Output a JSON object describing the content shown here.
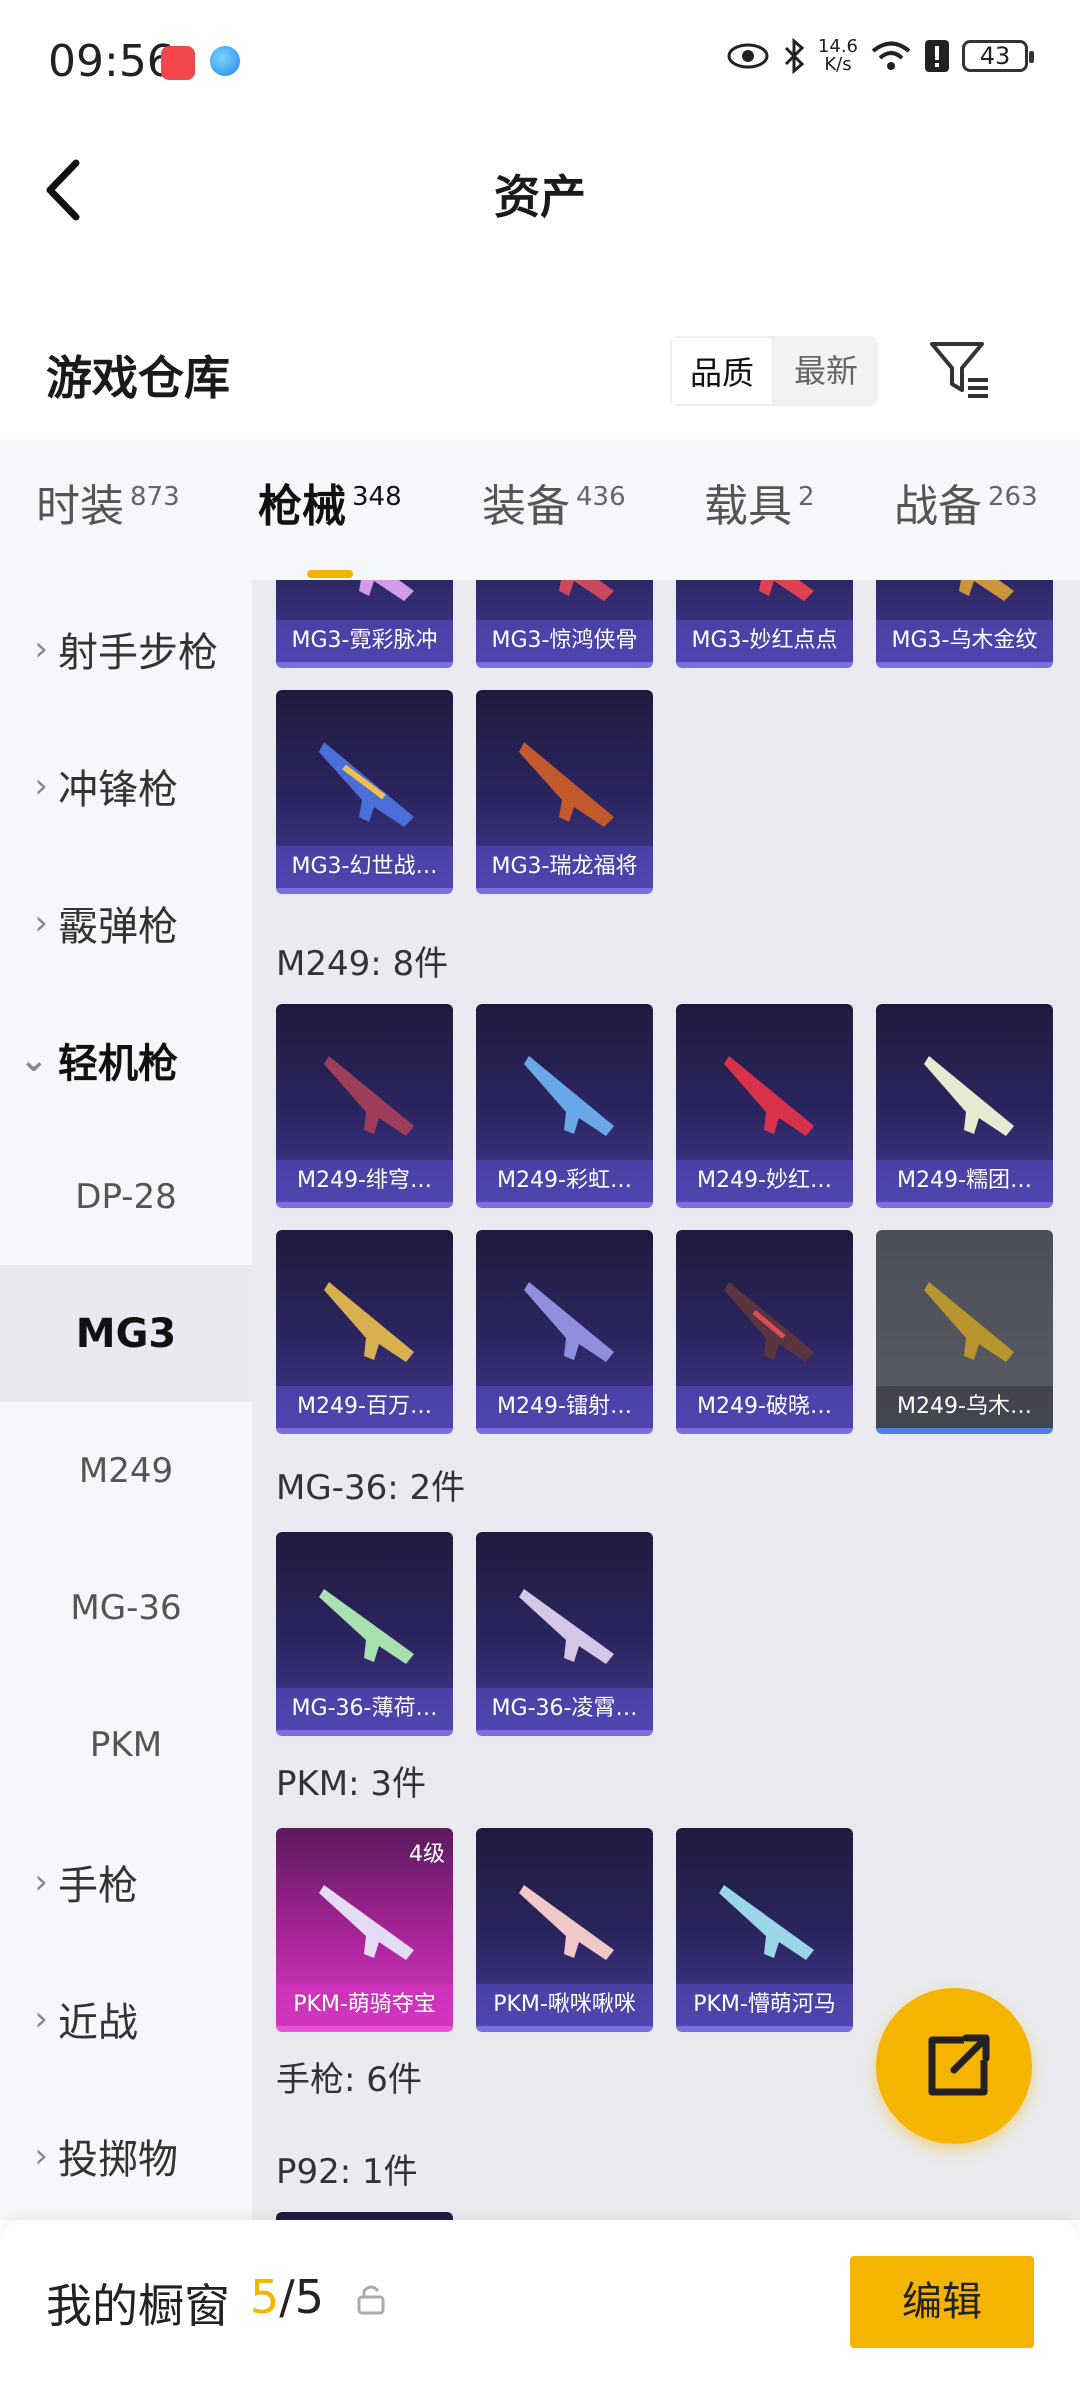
{
  "status": {
    "time": "09:56",
    "speed_value": "14.6",
    "speed_unit": "K/s",
    "battery": "43"
  },
  "header": {
    "title": "资产"
  },
  "warehouse": {
    "label": "游戏仓库",
    "sort_quality": "品质",
    "sort_newest": "最新"
  },
  "tabs": [
    {
      "label": "时装",
      "count": "873"
    },
    {
      "label": "枪械",
      "count": "348"
    },
    {
      "label": "装备",
      "count": "436"
    },
    {
      "label": "载具",
      "count": "2"
    },
    {
      "label": "战备",
      "count": "263"
    }
  ],
  "sidebar": [
    {
      "label": "射手步枪"
    },
    {
      "label": "冲锋枪"
    },
    {
      "label": "霰弹枪"
    },
    {
      "label": "轻机枪"
    },
    {
      "label": "DP-28"
    },
    {
      "label": "MG3"
    },
    {
      "label": "M249"
    },
    {
      "label": "MG-36"
    },
    {
      "label": "PKM"
    },
    {
      "label": "手枪"
    },
    {
      "label": "近战"
    },
    {
      "label": "投掷物"
    }
  ],
  "groups": {
    "mg3": {
      "items": [
        "MG3-霓彩脉冲",
        "MG3-惊鸿侠骨",
        "MG3-妙红点点",
        "MG3-乌木金纹",
        "MG3-幻世战…",
        "MG3-瑞龙福将"
      ]
    },
    "m249": {
      "header": "M249: 8件",
      "items": [
        "M249-绯穹…",
        "M249-彩虹…",
        "M249-妙红…",
        "M249-糯团…",
        "M249-百万…",
        "M249-镭射…",
        "M249-破晓…",
        "M249-乌木…"
      ]
    },
    "mg36": {
      "header": "MG-36: 2件",
      "items": [
        "MG-36-薄荷…",
        "MG-36-凌霄…"
      ]
    },
    "pkm": {
      "header": "PKM: 3件",
      "level": "4级",
      "items": [
        "PKM-萌骑夺宝",
        "PKM-啾咪啾咪",
        "PKM-懵萌河马"
      ]
    },
    "pistol": {
      "header": "手枪: 6件"
    },
    "p92": {
      "header": "P92: 1件"
    }
  },
  "bottom": {
    "label": "我的橱窗",
    "count_current": "5",
    "count_total": "/5",
    "edit": "编辑"
  },
  "colors": {
    "accent": "#f5b400",
    "card_purple": "#2b2560",
    "card_pink": "#b0259f"
  }
}
